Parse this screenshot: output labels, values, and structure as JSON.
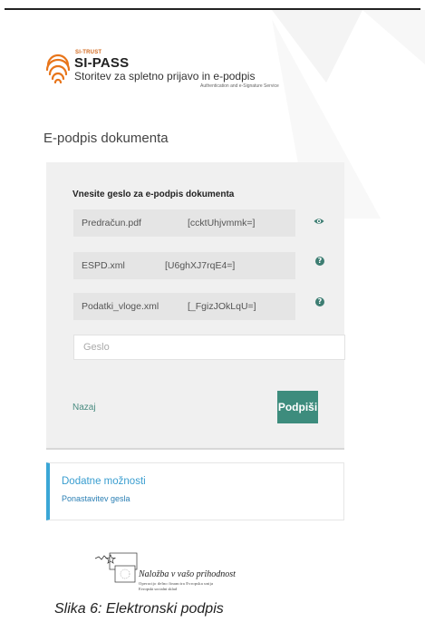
{
  "header": {
    "brand_small": "SI-TRUST",
    "brand_big": "SI-PASS",
    "description": "Storitev za spletno prijavo in e-podpis",
    "subtitle": "Authentication and e-Signature Service"
  },
  "page": {
    "title": "E-podpis dokumenta"
  },
  "panel": {
    "title": "Vnesite geslo za e-podpis dokumenta",
    "files": [
      {
        "name": "Predračun.pdf",
        "hash": "[ccktUhjvmmk=]",
        "icon": "eye-icon"
      },
      {
        "name": "ESPD.xml",
        "hash": "[U6ghXJ7rqE4=]",
        "icon": "help-icon"
      },
      {
        "name": "Podatki_vloge.xml",
        "hash": "[_FgizJOkLqU=]",
        "icon": "help-icon"
      }
    ],
    "password_placeholder": "Geslo",
    "back_label": "Nazaj",
    "sign_label": "Podpiši"
  },
  "options": {
    "title": "Dodatne možnosti",
    "reset_link": "Ponastavitev gesla"
  },
  "eu": {
    "main": "Naložba v vašo prihodnost",
    "sub1": "Operacijo delno financira Evropska unija",
    "sub2": "Evropski socialni sklad"
  },
  "caption": "Slika 6:   Elektronski podpis",
  "colors": {
    "accent": "#3d8c7d",
    "link_blue": "#3a9ed0",
    "panel_bg": "#f0f0f0",
    "logo_orange": "#e8751a"
  }
}
